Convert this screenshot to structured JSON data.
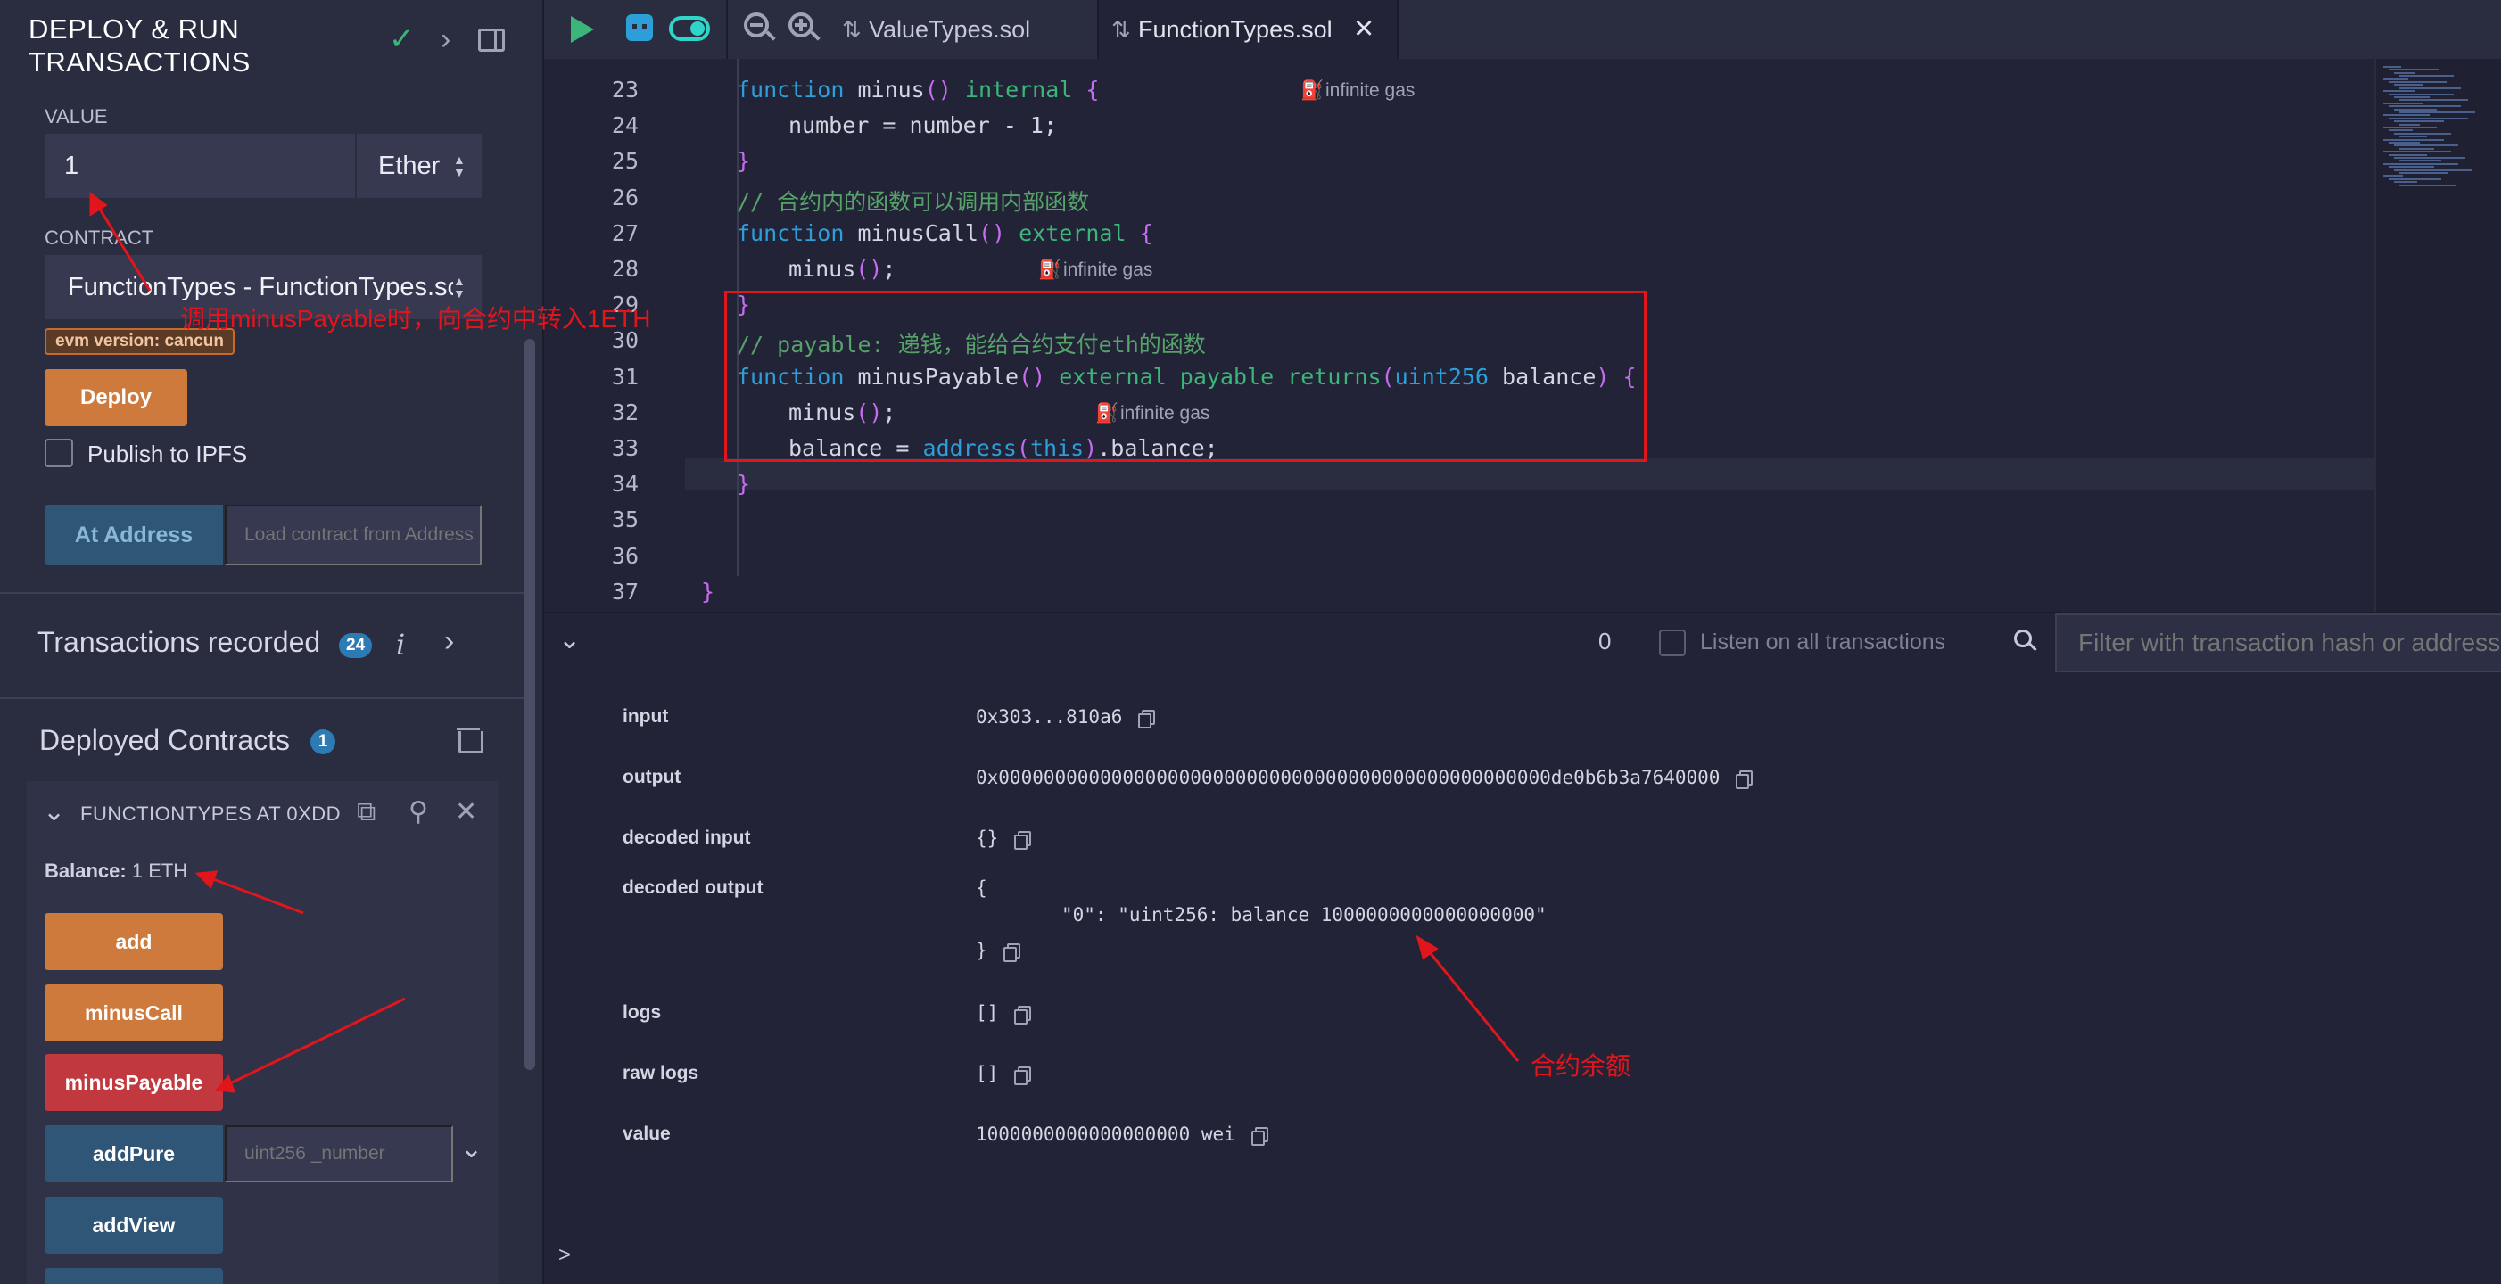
{
  "left_panel": {
    "title": "DEPLOY & RUN TRANSACTIONS",
    "value_label": "VALUE",
    "value_input": "1",
    "value_unit": "Ether",
    "contract_label": "CONTRACT",
    "contract_selected": "FunctionTypes - FunctionTypes.sol",
    "evm_badge": "evm version: cancun",
    "deploy_button": "Deploy",
    "publish_ipfs_label": "Publish to IPFS",
    "at_address_button": "At Address",
    "at_address_placeholder": "Load contract from Address",
    "transactions_recorded_label": "Transactions recorded",
    "transactions_recorded_count": "24",
    "deployed_contracts_label": "Deployed Contracts",
    "deployed_contracts_count": "1",
    "instance_name": "FUNCTIONTYPES AT 0XDD",
    "balance_label": "Balance:",
    "balance_value": "1 ETH",
    "functions": [
      "add",
      "minusCall",
      "minusPayable",
      "addPure",
      "addView"
    ],
    "addpure_placeholder": "uint256 _number"
  },
  "tabs": [
    {
      "label": "ValueTypes.sol",
      "active": false
    },
    {
      "label": "FunctionTypes.sol",
      "active": true
    }
  ],
  "editor": {
    "lines": [
      {
        "n": "23",
        "code": "function minus() internal {",
        "gas": "infinite gas"
      },
      {
        "n": "24",
        "code": "number = number - 1;"
      },
      {
        "n": "25",
        "code": "}"
      },
      {
        "n": "26",
        "code": "// 合约内的函数可以调用内部函数"
      },
      {
        "n": "27",
        "code": "function minusCall() external {"
      },
      {
        "n": "28",
        "code": "minus();",
        "gas": "infinite gas"
      },
      {
        "n": "29",
        "code": "}"
      },
      {
        "n": "30",
        "code": "// payable: 递钱，能给合约支付eth的函数"
      },
      {
        "n": "31",
        "code": "function minusPayable() external payable returns(uint256 balance) {"
      },
      {
        "n": "32",
        "code": "minus();",
        "gas": "infinite gas"
      },
      {
        "n": "33",
        "code": "balance = address(this).balance;"
      },
      {
        "n": "34",
        "code": "}"
      },
      {
        "n": "35",
        "code": ""
      },
      {
        "n": "36",
        "code": ""
      },
      {
        "n": "37",
        "code": "}"
      }
    ]
  },
  "terminal": {
    "pending_count": "0",
    "listen_label": "Listen on all transactions",
    "filter_placeholder": "Filter with transaction hash or address",
    "rows": {
      "input_key": "input",
      "input_val": "0x303...810a6",
      "output_key": "output",
      "output_val": "0x0000000000000000000000000000000000000000000000000de0b6b3a7640000",
      "decoded_input_key": "decoded input",
      "decoded_input_val": "{}",
      "decoded_output_key": "decoded output",
      "decoded_output_open": "{",
      "decoded_output_entry": "\"0\": \"uint256: balance 1000000000000000000\"",
      "decoded_output_close": "}",
      "logs_key": "logs",
      "logs_val": "[]",
      "raw_logs_key": "raw logs",
      "raw_logs_val": "[]",
      "value_key": "value",
      "value_val": "1000000000000000000 wei"
    },
    "prompt": ">"
  },
  "annotations": {
    "value_note": "调用minusPayable时，向合约中转入1ETH",
    "balance_note": "合约余额"
  },
  "colors": {
    "accent_orange": "#cf7a3d",
    "accent_red": "#c2383f",
    "accent_blue": "#2f5676",
    "annotation_red": "#e0161c"
  }
}
